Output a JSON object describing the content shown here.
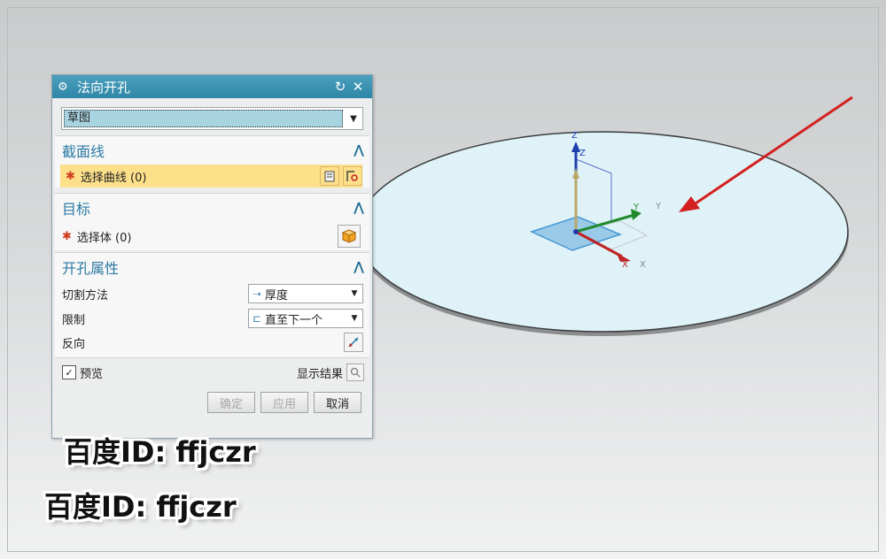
{
  "dialog": {
    "title": "法向开孔",
    "type_value": "草图",
    "sections": {
      "section_curve": {
        "title": "截面线",
        "select_label": "选择曲线 (0)"
      },
      "target": {
        "title": "目标",
        "select_label": "选择体 (0)"
      },
      "hole_props": {
        "title": "开孔属性",
        "cut_method_label": "切割方法",
        "cut_method_value": "厚度",
        "limit_label": "限制",
        "limit_value": "直至下一个",
        "reverse_label": "反向"
      }
    },
    "preview_label": "预览",
    "show_result_label": "显示结果",
    "buttons": {
      "ok": "确定",
      "apply": "应用",
      "cancel": "取消"
    }
  },
  "triad": {
    "z": "Z",
    "y": "Y",
    "x": "X"
  },
  "watermarks": [
    "百度ID: ffjczr",
    "百度ID: ffjczr"
  ],
  "colors": {
    "title_bar": "#2e86a6",
    "highlight": "#fde08a",
    "disk_fill": "#dff2f7",
    "arrow": "#d42020"
  }
}
